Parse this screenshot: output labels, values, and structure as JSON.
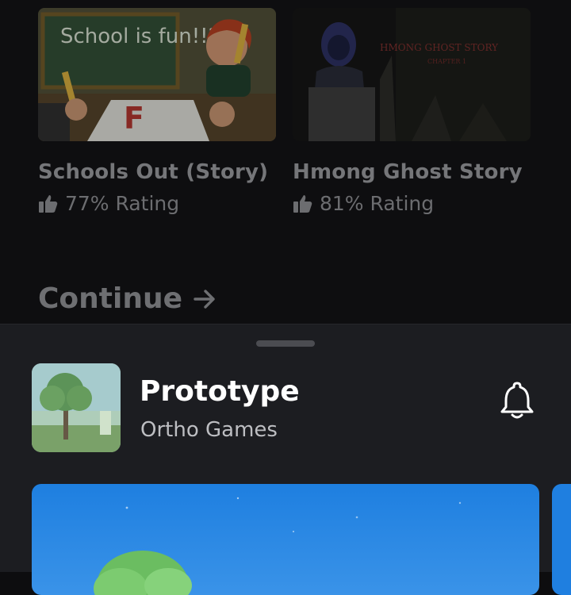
{
  "games": [
    {
      "title": "Schools Out (Story)",
      "rating": "77% Rating",
      "thumbnail_text": "School is fun!!?",
      "thumbnail_grade": "F"
    },
    {
      "title": "Hmong Ghost Story",
      "rating": "81% Rating",
      "thumbnail_text": "HMONG GHOST STORY",
      "thumbnail_sub": "CHAPTER 1"
    }
  ],
  "continue_label": "Continue",
  "sheet": {
    "title": "Prototype",
    "developer": "Ortho Games"
  },
  "icons": {
    "rating": "thumbs-up-icon",
    "continue": "arrow-right-icon",
    "notify": "bell-icon"
  },
  "colors": {
    "background": "#0e0e10",
    "sheet": "#1c1d21",
    "media_sky": "#1f7fe0"
  }
}
